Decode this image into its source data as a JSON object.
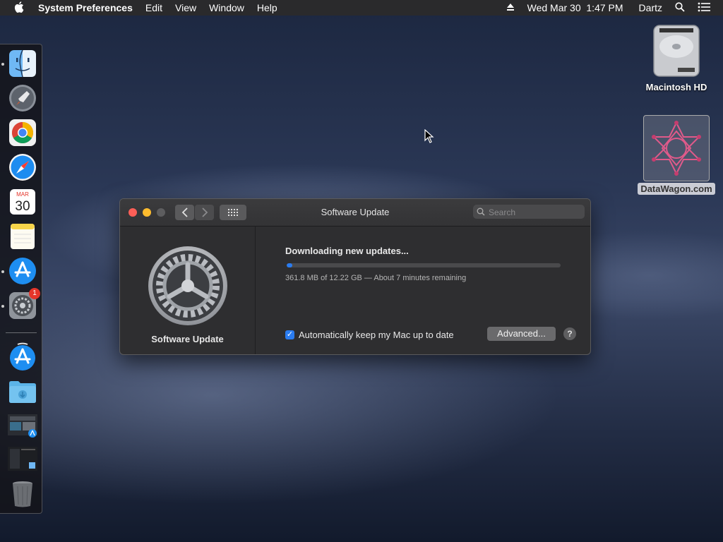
{
  "menubar": {
    "apple": "",
    "app_name": "System Preferences",
    "menus": [
      "Edit",
      "View",
      "Window",
      "Help"
    ],
    "clock": "Wed Mar 30  1:47 PM",
    "user": "Dartz",
    "icons": [
      "eject-icon",
      "spotlight-search-icon",
      "notification-center-icon"
    ]
  },
  "dock": {
    "items": [
      "Finder",
      "Launchpad",
      "Google Chrome",
      "Safari",
      "Calendar",
      "Notes",
      "App Store",
      "System Preferences",
      "App Store Downloads",
      "Downloads folder",
      "Screenshot",
      "Screenshot",
      "Trash"
    ],
    "calendar_month": "MAR",
    "calendar_day": "30",
    "sysprefs_badge": "1"
  },
  "desktop": {
    "drive_label": "Macintosh HD",
    "image_label": "DataWagon.com"
  },
  "window": {
    "title": "Software Update",
    "search_placeholder": "Search",
    "pane_label": "Software Update",
    "status_text": "Downloading new updates...",
    "progress_fraction": 0.02,
    "detail_text": "361.8 MB of 12.22 GB — About 7 minutes remaining",
    "auto_update_label": "Automatically keep my Mac up to date",
    "auto_update_checked": true,
    "advanced_label": "Advanced...",
    "help_label": "?",
    "accent_color": "#2a7cf0"
  }
}
